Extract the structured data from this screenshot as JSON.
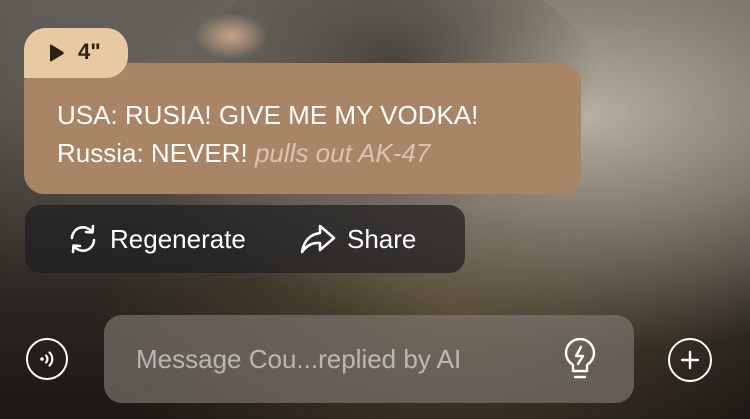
{
  "message": {
    "duration_label": "4\"",
    "line1": "USA: RUSIA! GIVE ME MY VODKA!",
    "line2_speech": "Russia: NEVER!",
    "line2_action": "pulls out AK-47"
  },
  "actions": {
    "regenerate_label": "Regenerate",
    "share_label": "Share"
  },
  "composer": {
    "placeholder": "Message Cou...replied by AI"
  },
  "icons": {
    "play": "play-icon",
    "regenerate": "refresh-icon",
    "share": "share-arrow-icon",
    "voice": "voice-call-icon",
    "hint": "lightbulb-icon",
    "add": "plus-icon"
  },
  "colors": {
    "bubble": "#a98465",
    "duration_tab": "#e9c99f",
    "action_text": "#d9c4b3"
  }
}
